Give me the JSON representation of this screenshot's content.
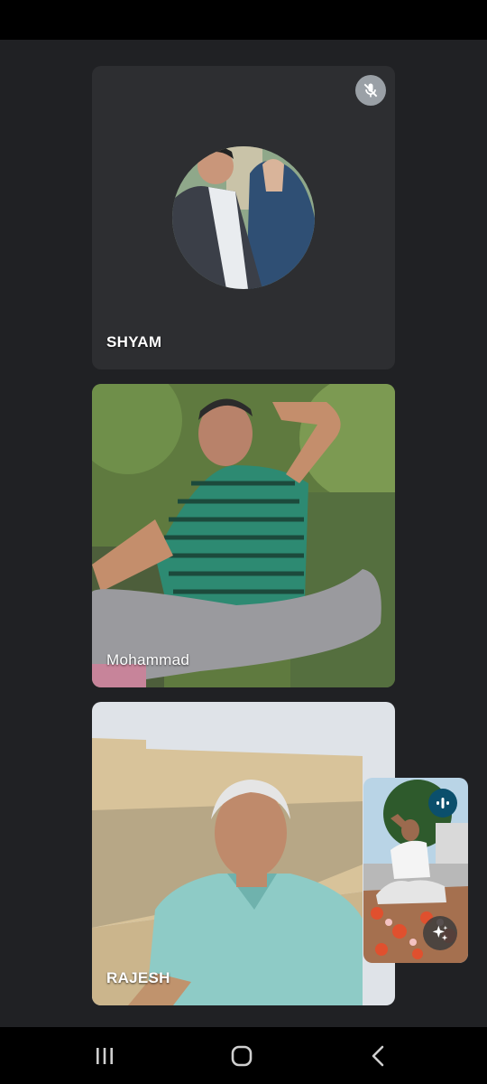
{
  "participants": [
    {
      "name": "SHYAM",
      "muted": true,
      "camera_on": false
    },
    {
      "name": "Mohammad",
      "camera_on": true
    },
    {
      "name": "RAJESH",
      "camera_on": true
    }
  ],
  "self_view": {
    "speaking": true
  },
  "nav_bar": {
    "buttons": [
      "recent-apps-icon",
      "home-icon",
      "back-icon"
    ]
  },
  "colors": {
    "background": "#202124",
    "tile": "#2d2e31",
    "speaking_badge": "#0b4f6c",
    "mute_badge": "#9aa0a6"
  }
}
